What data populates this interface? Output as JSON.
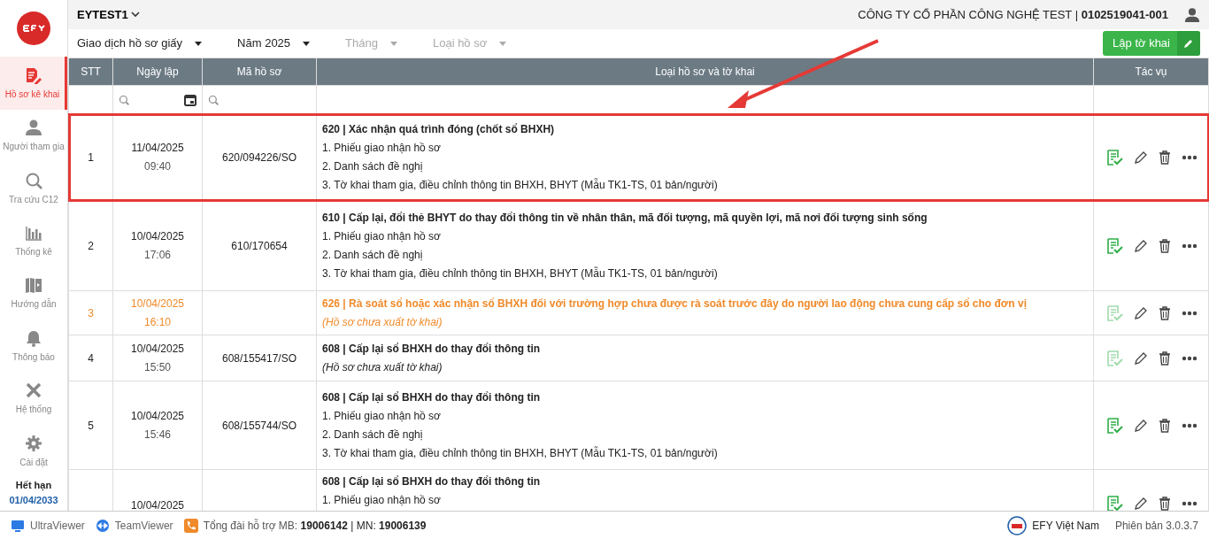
{
  "sidebar": {
    "items": [
      {
        "label": "Hồ sơ kê khai",
        "selected": true
      },
      {
        "label": "Người tham gia",
        "selected": false
      },
      {
        "label": "Tra cứu C12",
        "selected": false
      },
      {
        "label": "Thống kê",
        "selected": false
      },
      {
        "label": "Hướng dẫn",
        "selected": false
      },
      {
        "label": "Thông báo",
        "selected": false
      },
      {
        "label": "Hệ thống",
        "selected": false
      },
      {
        "label": "Cài đặt",
        "selected": false
      }
    ],
    "expiry_label": "Hết hạn",
    "expiry_date": "01/04/2033"
  },
  "header": {
    "account": "EYTEST1",
    "company": "CÔNG TY CỔ PHẦN CÔNG NGHỆ TEST | ",
    "tax_code": "0102519041-001"
  },
  "filters": [
    {
      "value": "Giao dịch hồ sơ giấy"
    },
    {
      "value": "Năm 2025"
    },
    {
      "placeholder": "Tháng"
    },
    {
      "placeholder": "Loại hồ sơ"
    }
  ],
  "create_button": "Lập tờ khai",
  "table": {
    "columns": [
      "STT",
      "Ngày lập",
      "Mã hồ sơ",
      "Loại hồ sơ và tờ khai",
      "Tác vụ"
    ],
    "rows": [
      {
        "stt": "1",
        "date": "11/04/2025",
        "time": "09:40",
        "code": "620/094226/SO",
        "title": "620 | Xác nhận quá trình đóng (chốt sổ BHXH)",
        "items": [
          "1. Phiếu giao nhận hồ sơ",
          "2. Danh sách đề nghị",
          "3. Tờ khai tham gia, điều chỉnh thông tin BHXH, BHYT (Mẫu TK1-TS, 01 bản/người)"
        ],
        "warning": false,
        "exported": true,
        "highlighted": true
      },
      {
        "stt": "2",
        "date": "10/04/2025",
        "time": "17:06",
        "code": "610/170654",
        "title": "610 | Cấp lại, đổi thẻ BHYT do thay đổi thông tin về nhân thân, mã đối tượng, mã quyền lợi, mã nơi đối tượng sinh sống",
        "items": [
          "1. Phiếu giao nhận hồ sơ",
          "2. Danh sách đề nghị",
          "3. Tờ khai tham gia, điều chỉnh thông tin BHXH, BHYT (Mẫu TK1-TS, 01 bản/người)"
        ],
        "warning": false,
        "exported": true,
        "highlighted": false
      },
      {
        "stt": "3",
        "date": "10/04/2025",
        "time": "16:10",
        "title": "626 | Rà soát sổ hoặc xác nhận sổ BHXH đối với trường hợp chưa được rà soát trước đây do người lao động chưa cung cấp sổ cho đơn vị",
        "note": "(Hồ sơ chưa xuất tờ khai)",
        "warning": true,
        "exported": false,
        "highlighted": false
      },
      {
        "stt": "4",
        "date": "10/04/2025",
        "time": "15:50",
        "code": "608/155417/SO",
        "title": "608 | Cấp lại sổ BHXH do thay đổi thông tin",
        "note": "(Hồ sơ chưa xuất tờ khai)",
        "warning": false,
        "exported": false,
        "highlighted": false
      },
      {
        "stt": "5",
        "date": "10/04/2025",
        "time": "15:46",
        "code": "608/155744/SO",
        "title": "608 | Cấp lại sổ BHXH do thay đổi thông tin",
        "items": [
          "1. Phiếu giao nhận hồ sơ",
          "2. Danh sách đề nghị",
          "3. Tờ khai tham gia, điều chỉnh thông tin BHXH, BHYT (Mẫu TK1-TS, 01 bản/người)"
        ],
        "warning": false,
        "exported": true,
        "highlighted": false
      },
      {
        "date": "10/04/2025",
        "title": "608 | Cấp lại sổ BHXH do thay đổi thông tin",
        "items": [
          "1. Phiếu giao nhận hồ sơ"
        ],
        "warning": false,
        "exported": true,
        "highlighted": false
      }
    ]
  },
  "footer": {
    "links": [
      {
        "label": "UltraViewer"
      },
      {
        "label": "TeamViewer"
      }
    ],
    "hotline_label": "Tổng đài hỗ trợ MB: ",
    "mb": "19006142",
    "sep": " | MN: ",
    "mn": "19006139",
    "brand": "EFY Việt Nam",
    "version": "Phiên bản 3.0.3.7"
  }
}
